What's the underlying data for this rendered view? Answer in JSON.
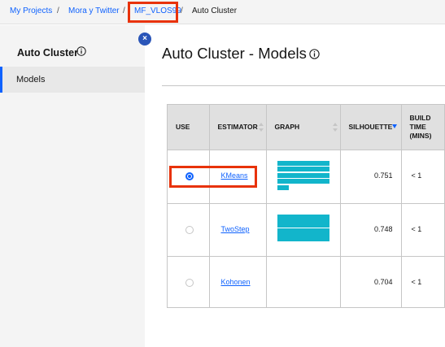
{
  "breadcrumbs": [
    {
      "label": "My Projects"
    },
    {
      "label": "Mora y Twitter"
    },
    {
      "label": "MF_VLOS99"
    },
    {
      "label": "Auto Cluster"
    }
  ],
  "breadcrumb_separator": "/",
  "sidebar": {
    "title": "Auto Cluster",
    "title_icon": "info-icon",
    "close_icon": "close-icon",
    "close_glyph": "×",
    "items": [
      {
        "label": "Models",
        "selected": true
      }
    ]
  },
  "main": {
    "title": "Auto Cluster - Models",
    "title_icon": "info-icon"
  },
  "table": {
    "columns": [
      "USE",
      "ESTIMATOR",
      "GRAPH",
      "SILHOUETTE",
      "BUILD TIME (MINS)"
    ],
    "sorted_column": "SILHOUETTE",
    "rows": [
      {
        "selected": true,
        "estimator": "KMeans",
        "graph_bars": 5,
        "silhouette": "0.751",
        "build_time": "< 1"
      },
      {
        "selected": false,
        "estimator": "TwoStep",
        "graph_bars": 2,
        "silhouette": "0.748",
        "build_time": "< 1"
      },
      {
        "selected": false,
        "estimator": "Kohonen",
        "graph_bars": 0,
        "silhouette": "0.704",
        "build_time": "< 1"
      }
    ]
  },
  "colors": {
    "accent": "#0f62fe",
    "graph_bar": "#12b5cb",
    "highlight_box": "#e8320a",
    "close_button": "#2a55b8"
  }
}
